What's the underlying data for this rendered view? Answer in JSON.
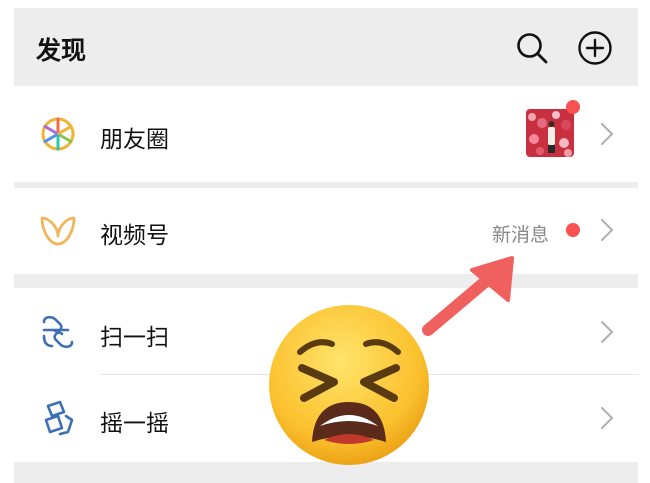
{
  "header": {
    "title": "发现",
    "search_icon": "search-icon",
    "add_icon": "plus-circle-icon"
  },
  "rows": [
    {
      "label": "朋友圈",
      "icon": "moments-aperture-icon",
      "has_thumbnail": true,
      "has_dot": true
    },
    {
      "label": "视频号",
      "icon": "channels-icon",
      "badge_text": "新消息",
      "has_dot": true
    },
    {
      "label": "扫一扫",
      "icon": "scan-icon"
    },
    {
      "label": "摇一摇",
      "icon": "shake-icon"
    }
  ],
  "overlay": {
    "arrow_color": "#f0605f",
    "emoji": "tired-face-emoji"
  },
  "colors": {
    "background": "#ededed",
    "dot": "#fa5151",
    "accent_blue": "#3d6fb5",
    "channels_gold": "#f2b55b"
  }
}
